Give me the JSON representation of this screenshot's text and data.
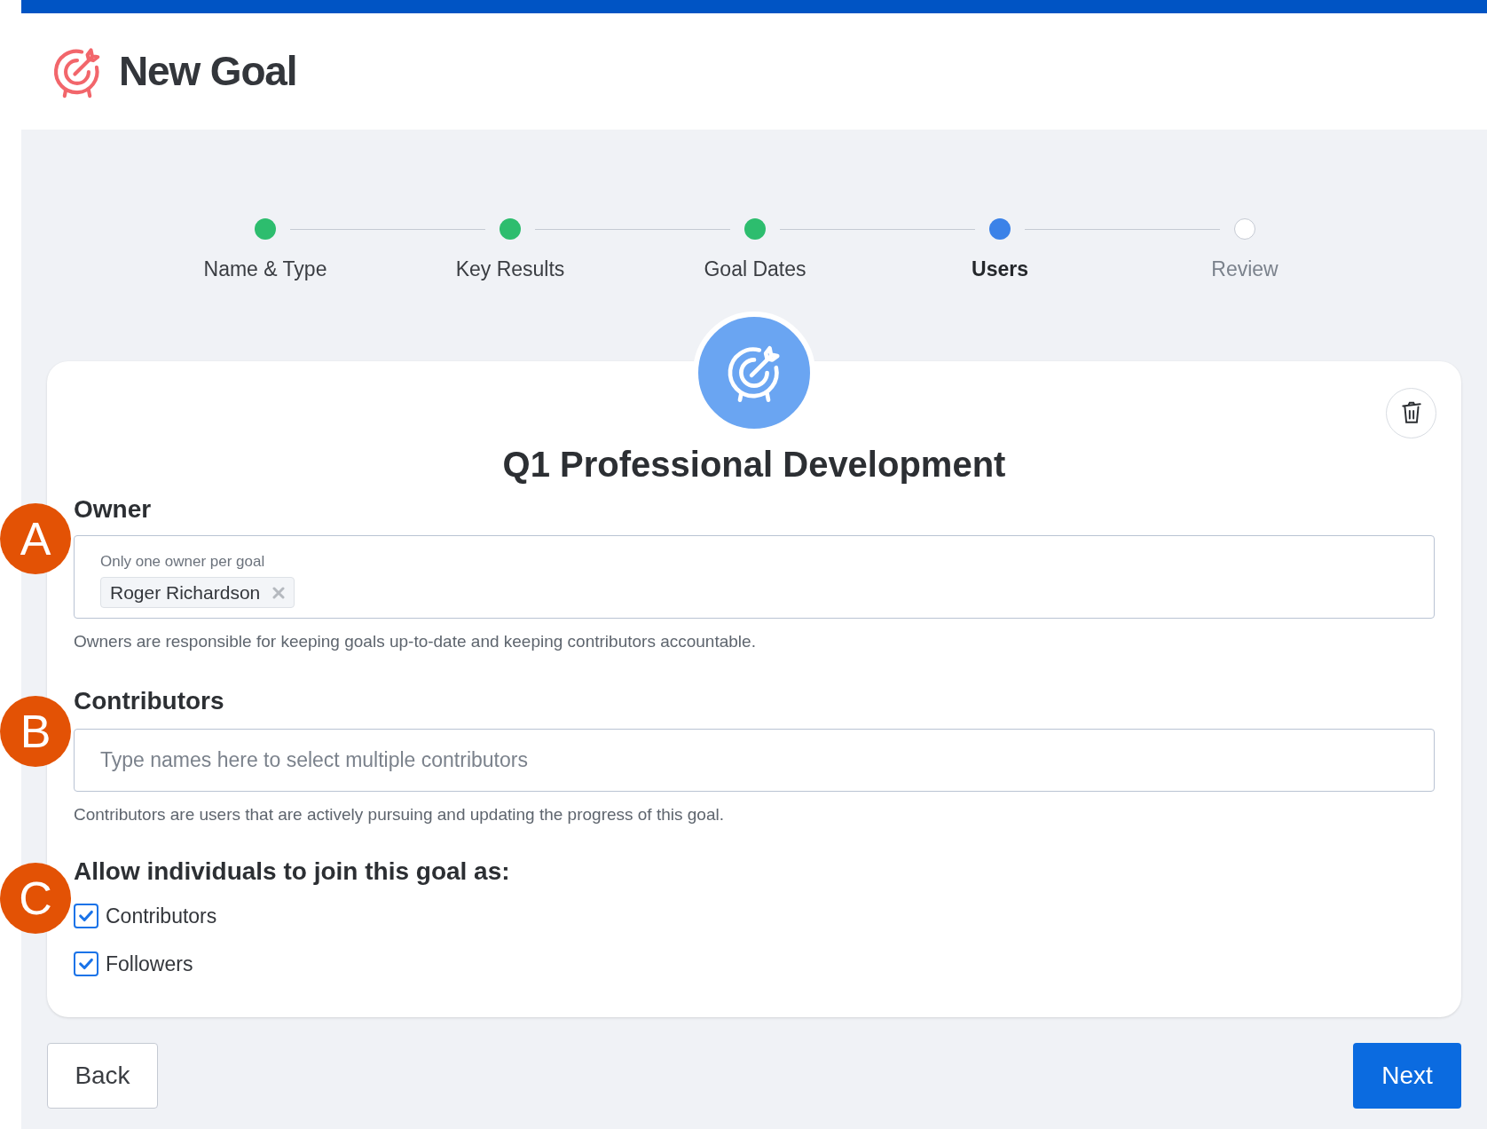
{
  "header": {
    "title": "New Goal"
  },
  "steps": [
    {
      "label": "Name & Type",
      "done": true,
      "selected": false
    },
    {
      "label": "Key Results",
      "done": true,
      "selected": false
    },
    {
      "label": "Goal Dates",
      "done": true,
      "selected": false
    },
    {
      "label": "Users",
      "done": false,
      "selected": true
    },
    {
      "label": "Review",
      "done": false,
      "selected": false
    }
  ],
  "goal": {
    "title": "Q1 Professional Development"
  },
  "owner": {
    "marker": "A",
    "label": "Owner",
    "field_label": "Only one owner per goal",
    "tags": [
      "Roger Richardson"
    ],
    "help": "Owners are responsible for keeping goals up-to-date and keeping contributors accountable."
  },
  "contributors": {
    "marker": "B",
    "label": "Contributors",
    "placeholder": "Type names here to select multiple contributors",
    "help": "Contributors are users that are actively pursuing and updating the progress of this goal."
  },
  "join": {
    "marker": "C",
    "label": "Allow individuals to join this goal as:",
    "options": [
      {
        "label": "Contributors",
        "checked": true
      },
      {
        "label": "Followers",
        "checked": true
      }
    ]
  },
  "buttons": {
    "back": "Back",
    "next": "Next"
  }
}
